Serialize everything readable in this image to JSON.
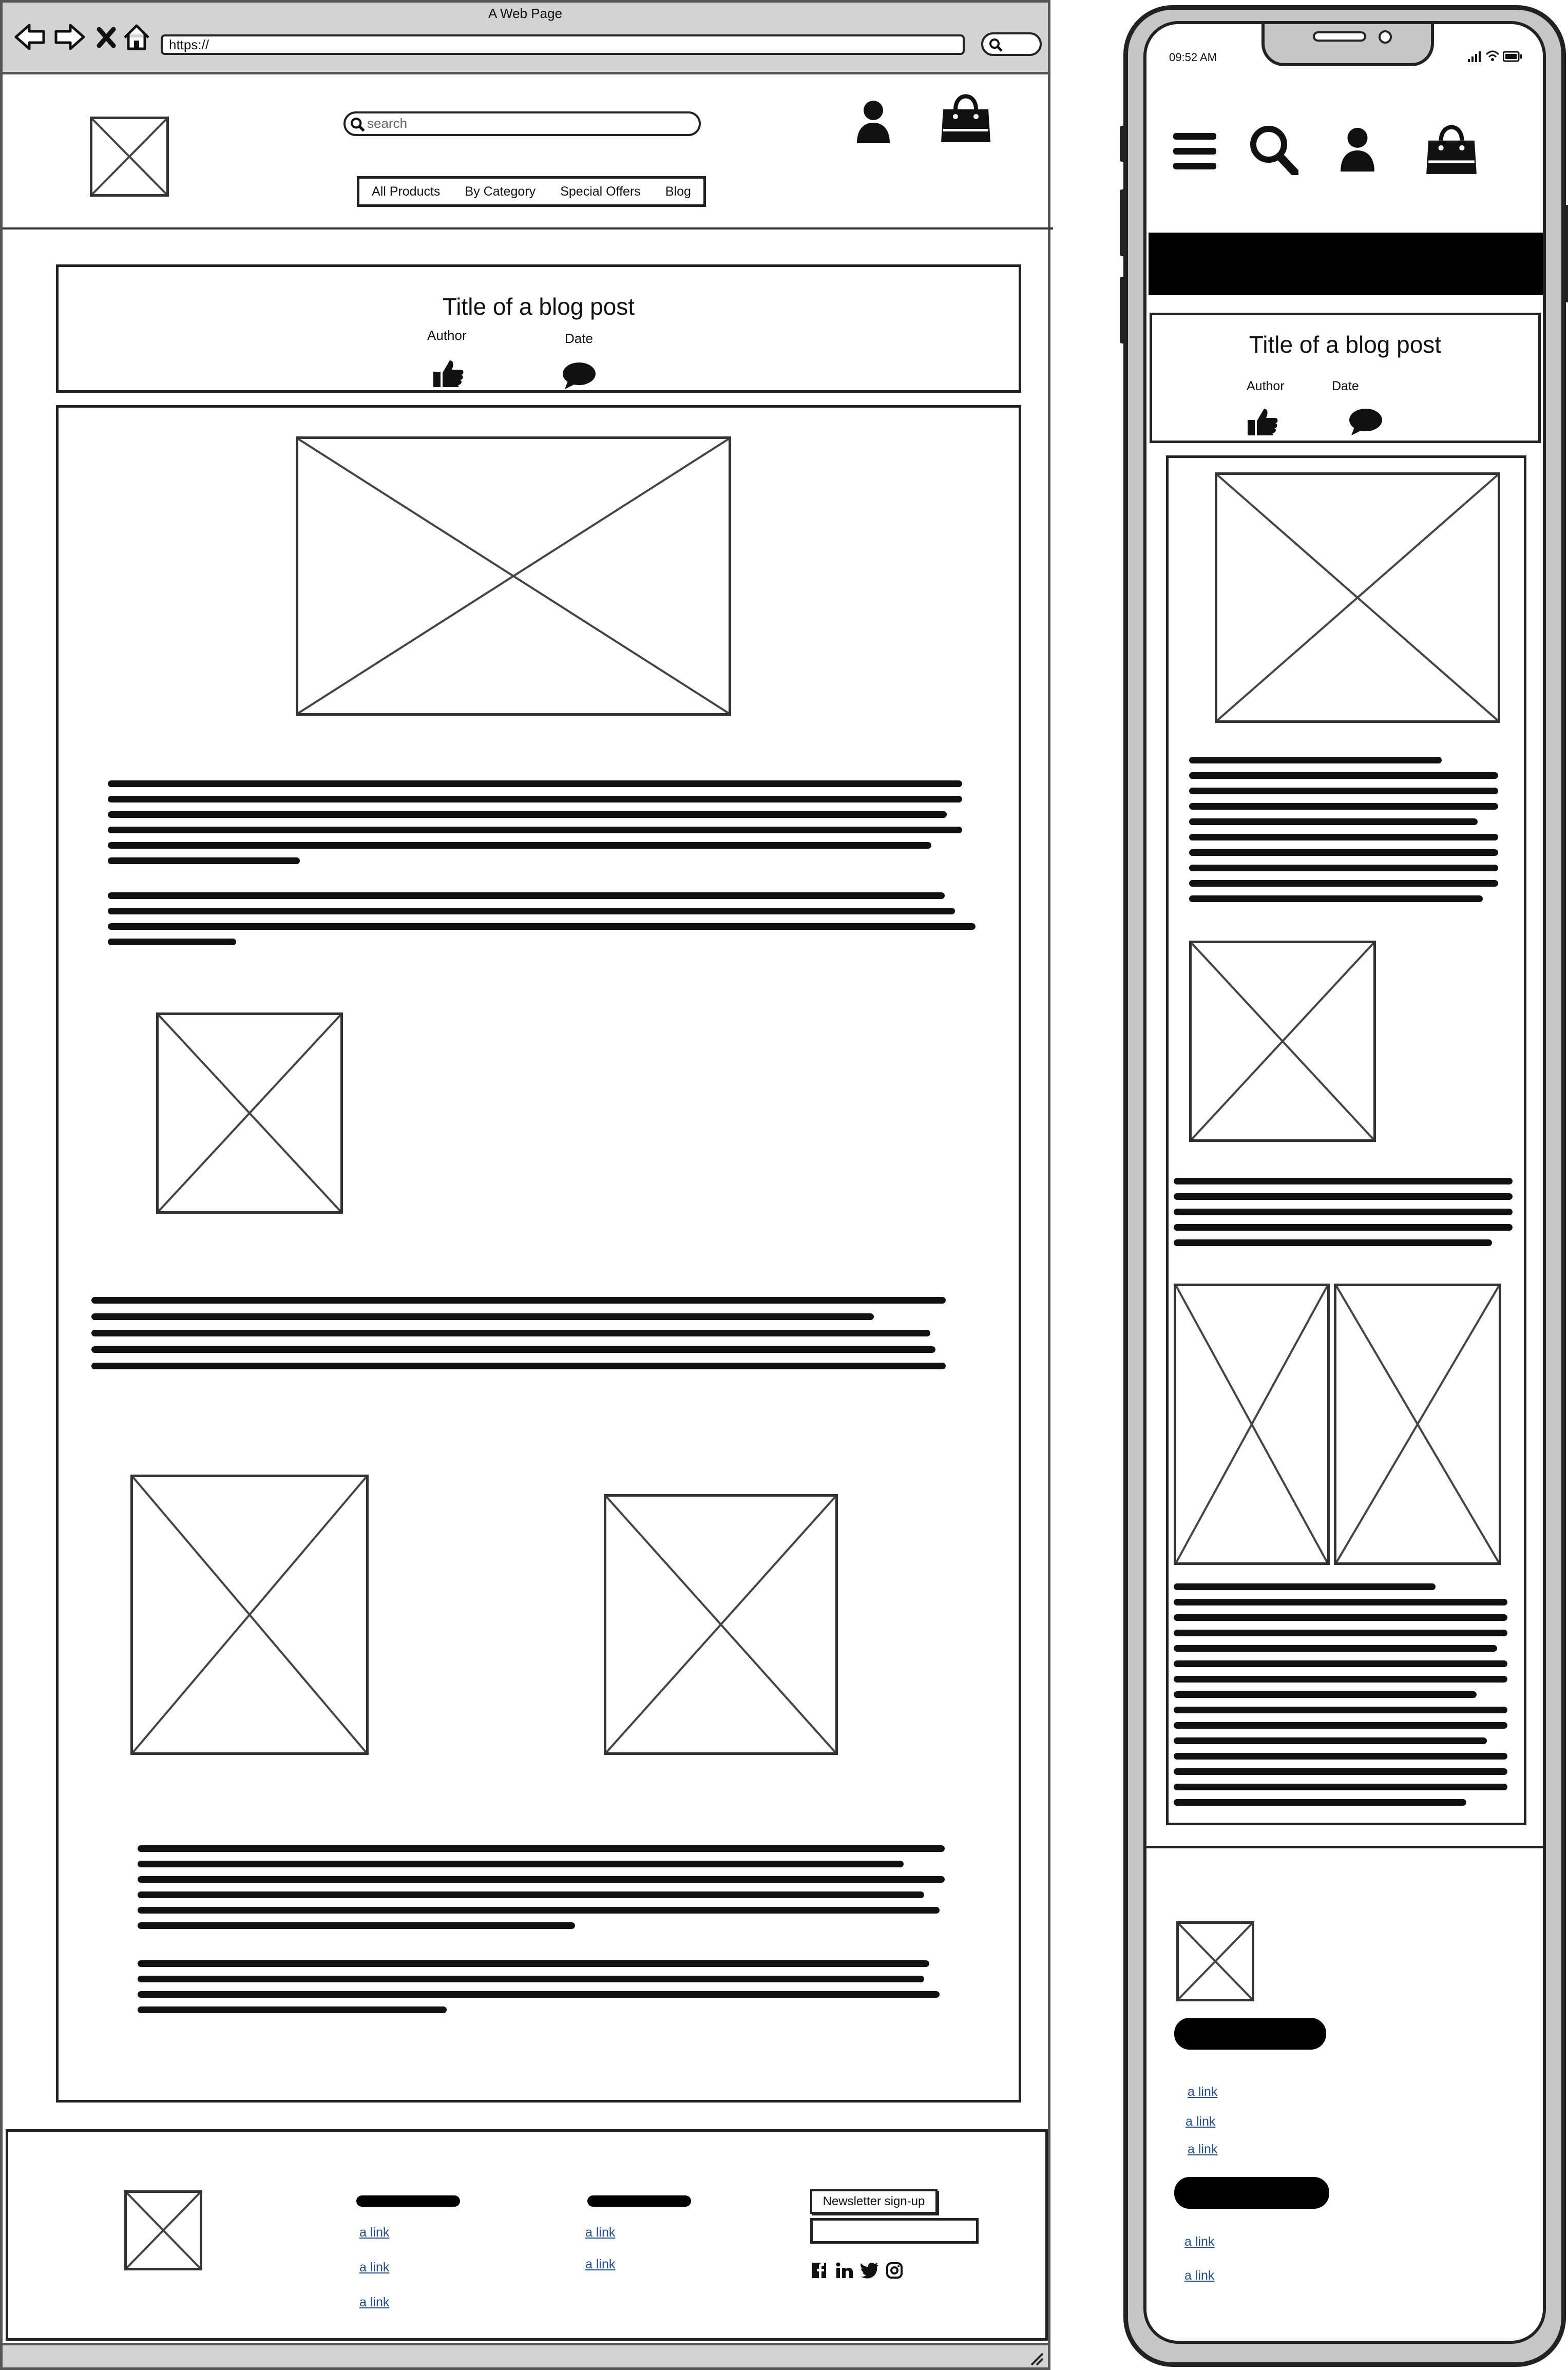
{
  "desktop": {
    "window_title": "A Web Page",
    "address": "https://",
    "search_placeholder": "search",
    "nav": [
      "All Products",
      "By Category",
      "Special Offers",
      "Blog"
    ],
    "post": {
      "title": "Title of a blog post",
      "author_label": "Author",
      "date_label": "Date"
    },
    "footer": {
      "col1_links": [
        "a link",
        "a link",
        "a link"
      ],
      "col2_links": [
        "a link",
        "a link"
      ],
      "newsletter_button": "Newsletter sign-up"
    }
  },
  "mobile": {
    "status_time": "09:52 AM",
    "post": {
      "title": "Title of a blog post",
      "author_label": "Author",
      "date_label": "Date"
    },
    "footer": {
      "group1_links": [
        "a link",
        "a link",
        "a link"
      ],
      "group2_links": [
        "a link",
        "a link"
      ]
    }
  },
  "icons": [
    "back-arrow-icon",
    "forward-arrow-icon",
    "close-icon",
    "home-icon",
    "search-icon",
    "user-icon",
    "shopping-bag-icon",
    "thumbs-up-icon",
    "comment-icon",
    "hamburger-menu-icon",
    "facebook-icon",
    "linkedin-icon",
    "twitter-icon",
    "instagram-icon",
    "resize-grip-icon",
    "wifi-icon",
    "battery-icon",
    "signal-icon"
  ]
}
